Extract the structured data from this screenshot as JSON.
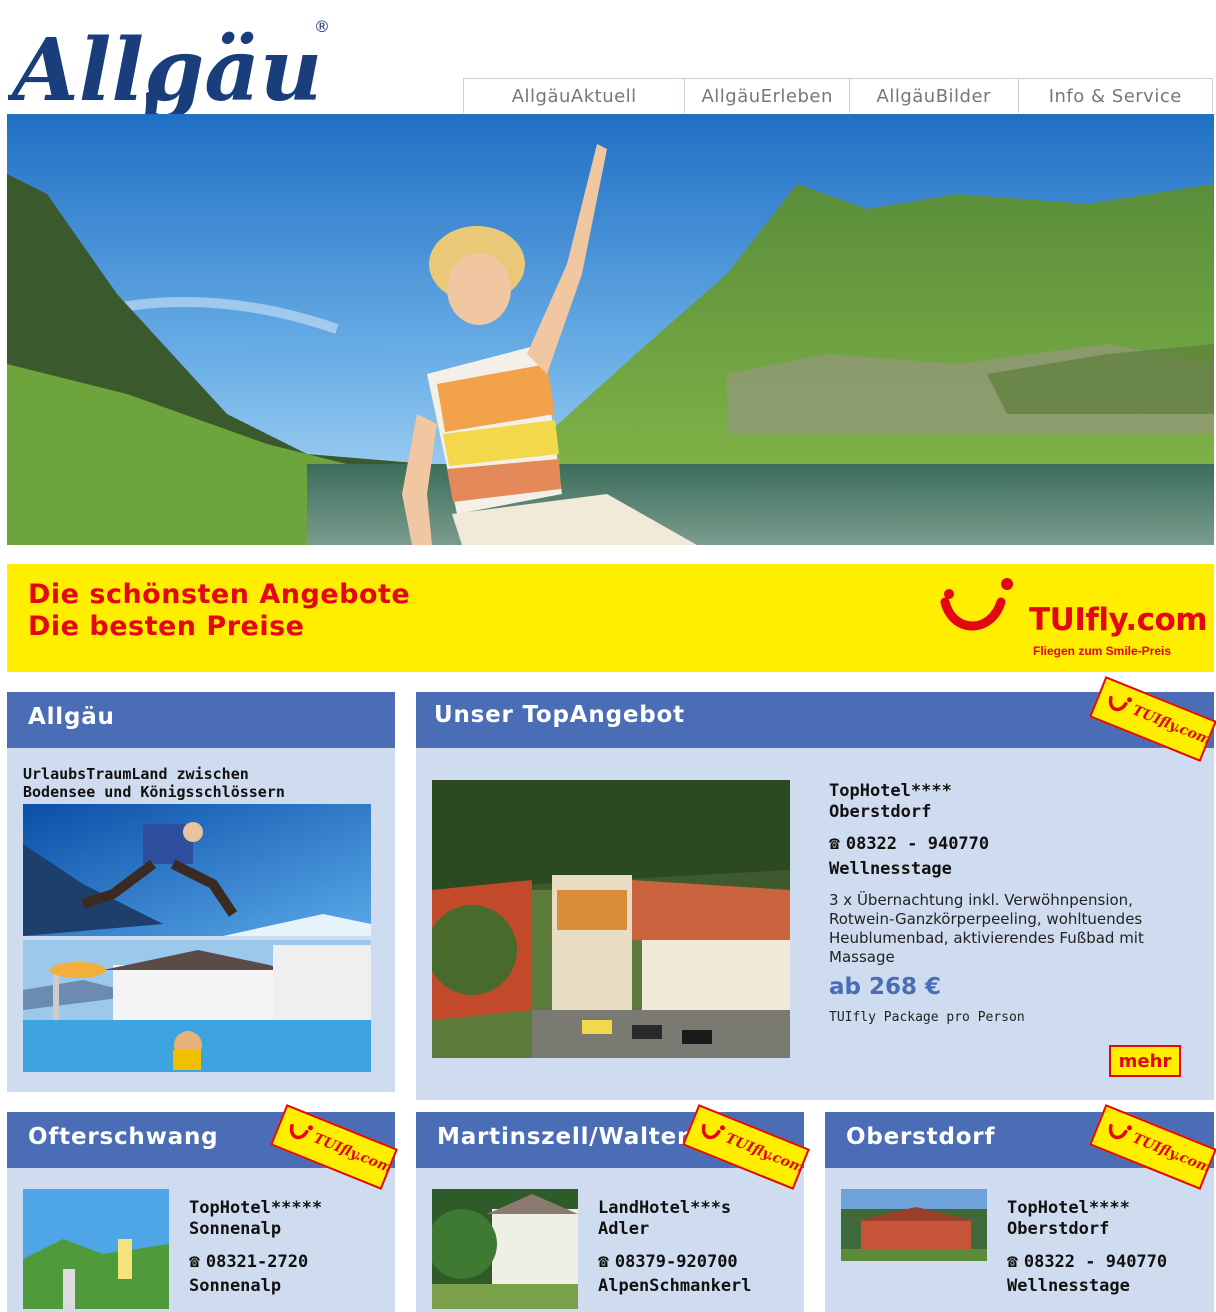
{
  "header": {
    "logo_text": "Allgäu",
    "nav": [
      "AllgäuAktuell",
      "AllgäuErleben",
      "AllgäuBilder",
      "Info & Service"
    ]
  },
  "banner": {
    "line1": "Die schönsten Angebote",
    "line2": "Die besten Preise",
    "brand": "TUIfly.com",
    "slogan": "Fliegen zum Smile-Preis"
  },
  "badge_text": "TUIfly.com",
  "allgaeu": {
    "title": "Allgäu",
    "subtitle_l1": "UrlaubsTraumLand zwischen",
    "subtitle_l2": "Bodensee und Königsschlössern"
  },
  "top_offer": {
    "title": "Unser TopAngebot",
    "hotel_l1": "TopHotel****",
    "hotel_l2": "Oberstdorf",
    "phone": "08322 - 940770",
    "package": "Wellnesstage",
    "desc_l1": "3 x Übernachtung inkl. Verwöhnpension,",
    "desc_l2": "Rotwein-Ganzkörperpeeling, wohltuendes",
    "desc_l3": "Heublumenbad, aktivierendes Fußbad mit",
    "desc_l4": "Massage",
    "price": "ab 268 €",
    "price_note": "TUIfly Package pro Person",
    "more": "mehr"
  },
  "cards": [
    {
      "title": "Ofterschwang",
      "hotel_l1": "TopHotel*****",
      "hotel_l2": "Sonnenalp",
      "phone": "08321-2720",
      "package": "Sonnenalp"
    },
    {
      "title": "Martinszell/Walten",
      "hotel_l1": "LandHotel***s",
      "hotel_l2": "Adler",
      "phone": "08379-920700",
      "package": "AlpenSchmankerl"
    },
    {
      "title": "Oberstdorf",
      "hotel_l1": "TopHotel****",
      "hotel_l2": "Oberstdorf",
      "phone": "08322 - 940770",
      "package": "Wellnesstage"
    }
  ],
  "colors": {
    "brand_blue": "#4a6db5",
    "panel_bg": "#cfdcf0",
    "tui_yellow": "#ffee00",
    "tui_red": "#e30613",
    "logo_navy": "#1a3d7c"
  },
  "icons": [
    "phone-icon",
    "tui-smile-icon"
  ]
}
